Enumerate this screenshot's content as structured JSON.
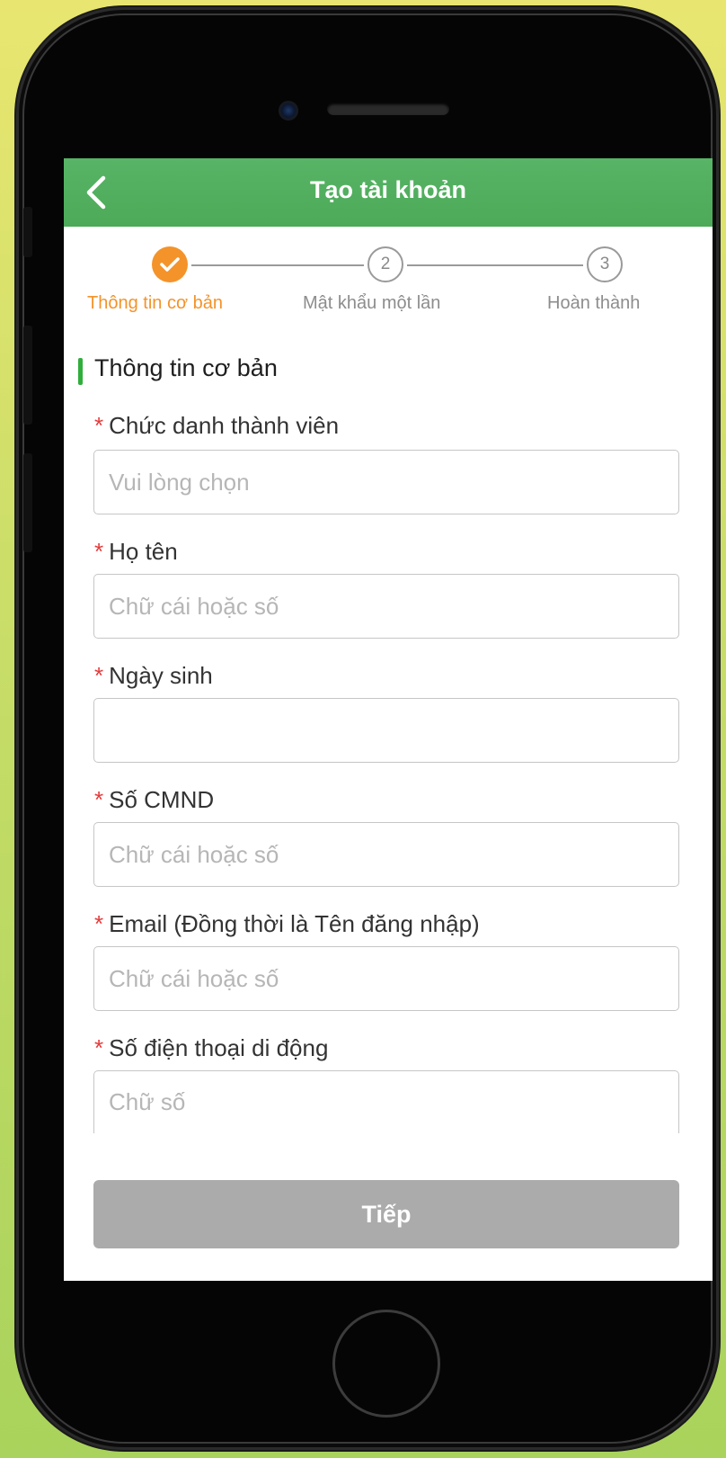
{
  "header": {
    "title": "Tạo tài khoản"
  },
  "stepper": {
    "steps": [
      {
        "number": "",
        "label": "Thông tin cơ bản",
        "state": "done"
      },
      {
        "number": "2",
        "label": "Mật khẩu một lần",
        "state": "pending"
      },
      {
        "number": "3",
        "label": "Hoàn thành",
        "state": "pending"
      }
    ]
  },
  "section": {
    "title": "Thông tin cơ bản"
  },
  "form": {
    "required_mark": "*",
    "fields": [
      {
        "label": "Chức danh thành viên",
        "value": "",
        "placeholder": "Vui lòng chọn"
      },
      {
        "label": "Họ tên",
        "value": "",
        "placeholder": "Chữ cái hoặc số"
      },
      {
        "label": "Ngày sinh",
        "value": "",
        "placeholder": ""
      },
      {
        "label": "Số CMND",
        "value": "",
        "placeholder": "Chữ cái hoặc số"
      },
      {
        "label": "Email (Đồng thời là Tên đăng nhập)",
        "value": "",
        "placeholder": "Chữ cái hoặc số"
      },
      {
        "label": "Số điện thoại di động",
        "value": "",
        "placeholder": "Chữ số"
      }
    ]
  },
  "footer": {
    "next_label": "Tiếp"
  },
  "colors": {
    "header_green": "#4caa58",
    "active_step": "#f4932a",
    "required": "#e33b3b",
    "section_bar": "#2fae3b",
    "button_disabled": "#ababab"
  },
  "icons": {
    "back": "chevron-left-icon",
    "step_done": "check-icon"
  }
}
